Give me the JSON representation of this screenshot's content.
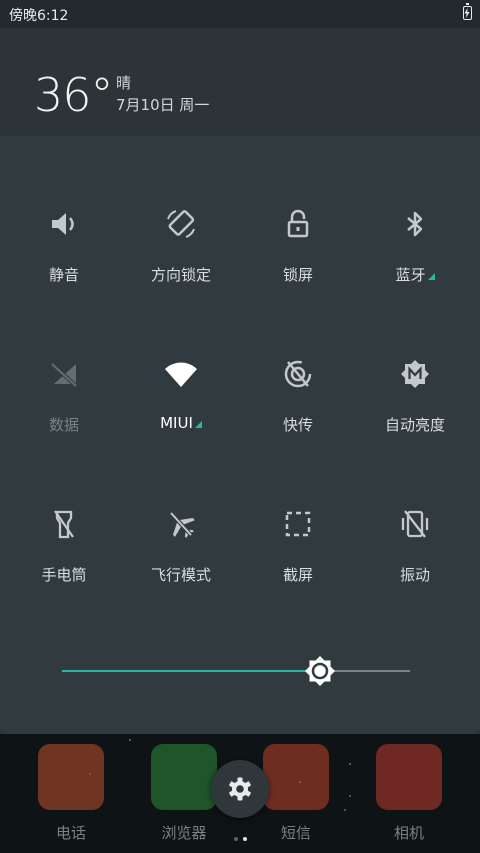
{
  "status": {
    "time": "傍晚6:12"
  },
  "weather": {
    "temperature": "36°",
    "condition": "晴",
    "date": "7月10日 周一"
  },
  "toggles": [
    {
      "label": "静音",
      "icon": "volume-icon",
      "active": true
    },
    {
      "label": "方向锁定",
      "icon": "rotation-lock-icon",
      "active": true
    },
    {
      "label": "锁屏",
      "icon": "lock-icon",
      "active": true
    },
    {
      "label": "蓝牙",
      "icon": "bluetooth-icon",
      "active": true,
      "has_more": true
    },
    {
      "label": "数据",
      "icon": "mobile-data-off-icon",
      "active": false
    },
    {
      "label": "MIUI",
      "icon": "wifi-icon",
      "active": true,
      "has_more": true
    },
    {
      "label": "快传",
      "icon": "quick-transfer-icon",
      "active": true
    },
    {
      "label": "自动亮度",
      "icon": "auto-brightness-icon",
      "active": true
    },
    {
      "label": "手电筒",
      "icon": "flashlight-icon",
      "active": true
    },
    {
      "label": "飞行模式",
      "icon": "airplane-icon",
      "active": true
    },
    {
      "label": "截屏",
      "icon": "screenshot-icon",
      "active": true
    },
    {
      "label": "振动",
      "icon": "vibrate-icon",
      "active": true
    }
  ],
  "brightness": {
    "level": 0.74
  },
  "dock": [
    {
      "label": "电话",
      "icon": "phone-app-icon",
      "color": "#c0502e"
    },
    {
      "label": "浏览器",
      "icon": "browser-app-icon",
      "color": "#2f8a3a"
    },
    {
      "label": "短信",
      "icon": "sms-app-icon",
      "color": "#c0442e"
    },
    {
      "label": "相机",
      "icon": "camera-app-icon",
      "color": "#c03a32"
    }
  ],
  "colors": {
    "accent": "#2ab39e",
    "panel": "#313a3e",
    "background": "#2d3438"
  }
}
